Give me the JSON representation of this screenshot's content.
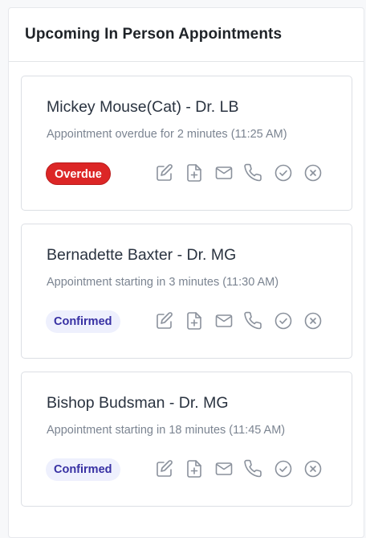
{
  "panel": {
    "title": "Upcoming In Person Appointments"
  },
  "appointments": [
    {
      "title": "Mickey Mouse(Cat) - Dr. LB",
      "subtitle": "Appointment overdue for 2 minutes (11:25 AM)",
      "status": "Overdue",
      "status_color": "#dc2626"
    },
    {
      "title": "Bernadette Baxter - Dr. MG",
      "subtitle": "Appointment starting in 3 minutes (11:30 AM)",
      "status": "Confirmed",
      "status_color": "#3730a3"
    },
    {
      "title": "Bishop Budsman - Dr. MG",
      "subtitle": "Appointment starting in 18 minutes (11:45 AM)",
      "status": "Confirmed",
      "status_color": "#3730a3"
    }
  ],
  "action_icons": [
    "edit-icon",
    "add-document-icon",
    "mail-icon",
    "phone-icon",
    "check-circle-icon",
    "cancel-circle-icon"
  ]
}
